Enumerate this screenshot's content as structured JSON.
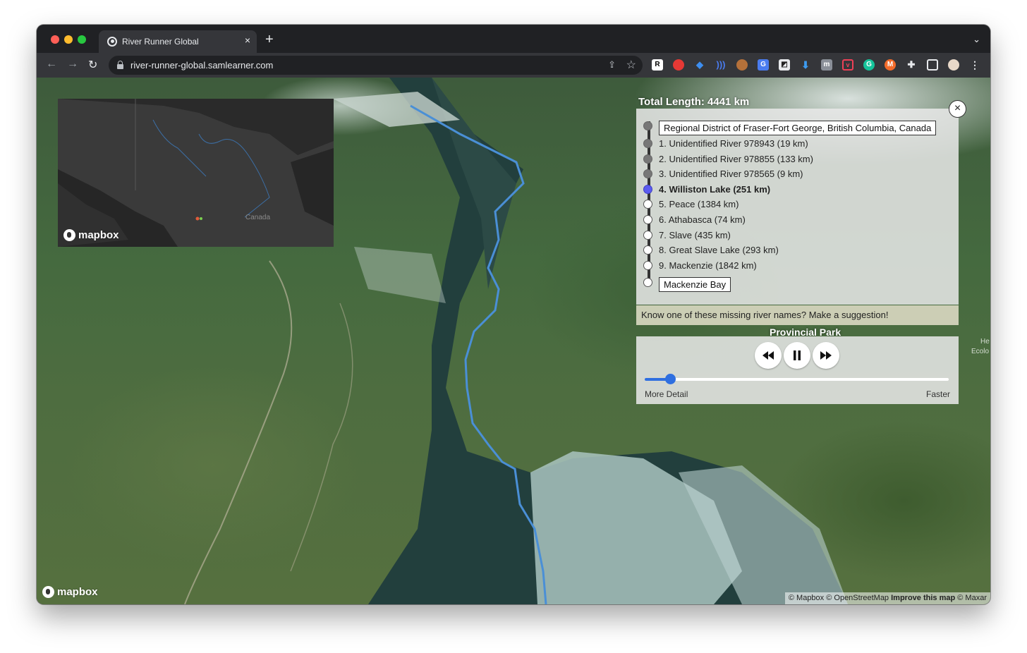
{
  "browser": {
    "tab_title": "River Runner Global",
    "tab_close": "×",
    "new_tab": "+",
    "url": "river-runner-global.samlearner.com",
    "extensions": [
      "R",
      "pokeball",
      "diamond",
      "wave",
      "monkey",
      "translate",
      "compass",
      "download",
      "m",
      "pocket",
      "grammarly",
      "m-circle",
      "puzzle",
      "sidebar",
      "avatar"
    ]
  },
  "minimap": {
    "country_label": "Canada",
    "logo_text": "mapbox"
  },
  "map": {
    "logo_text": "mapbox",
    "attribution": {
      "mapbox": "© Mapbox",
      "osm": "© OpenStreetMap",
      "improve": "Improve this map",
      "maxar": "© Maxar"
    },
    "labels": {
      "park": "Provincial Park",
      "he": "He",
      "ecolo": "Ecolo"
    }
  },
  "route": {
    "total_length": "Total Length: 4441 km",
    "close_label": "×",
    "start_place": "Regional District of Fraser-Fort George, British Columbia, Canada",
    "steps": [
      {
        "label": "1. Unidentified River 978943 (19 km)",
        "state": "done"
      },
      {
        "label": "2. Unidentified River 978855 (133 km)",
        "state": "done"
      },
      {
        "label": "3. Unidentified River 978565 (9 km)",
        "state": "done"
      },
      {
        "label": "4. Williston Lake (251 km)",
        "state": "current"
      },
      {
        "label": "5. Peace (1384 km)",
        "state": "pending"
      },
      {
        "label": "6. Athabasca (74 km)",
        "state": "pending"
      },
      {
        "label": "7. Slave (435 km)",
        "state": "pending"
      },
      {
        "label": "8. Great Slave Lake (293 km)",
        "state": "pending"
      },
      {
        "label": "9. Mackenzie (1842 km)",
        "state": "pending"
      }
    ],
    "end_place": "Mackenzie Bay",
    "suggestion": "Know one of these missing river names? Make a suggestion!"
  },
  "playback": {
    "speed_fraction": 0.085,
    "label_left": "More Detail",
    "label_right": "Faster"
  },
  "colors": {
    "river_line": "#4a8fd6",
    "current_step": "#5b5bf0",
    "slider": "#2f6fe0"
  }
}
